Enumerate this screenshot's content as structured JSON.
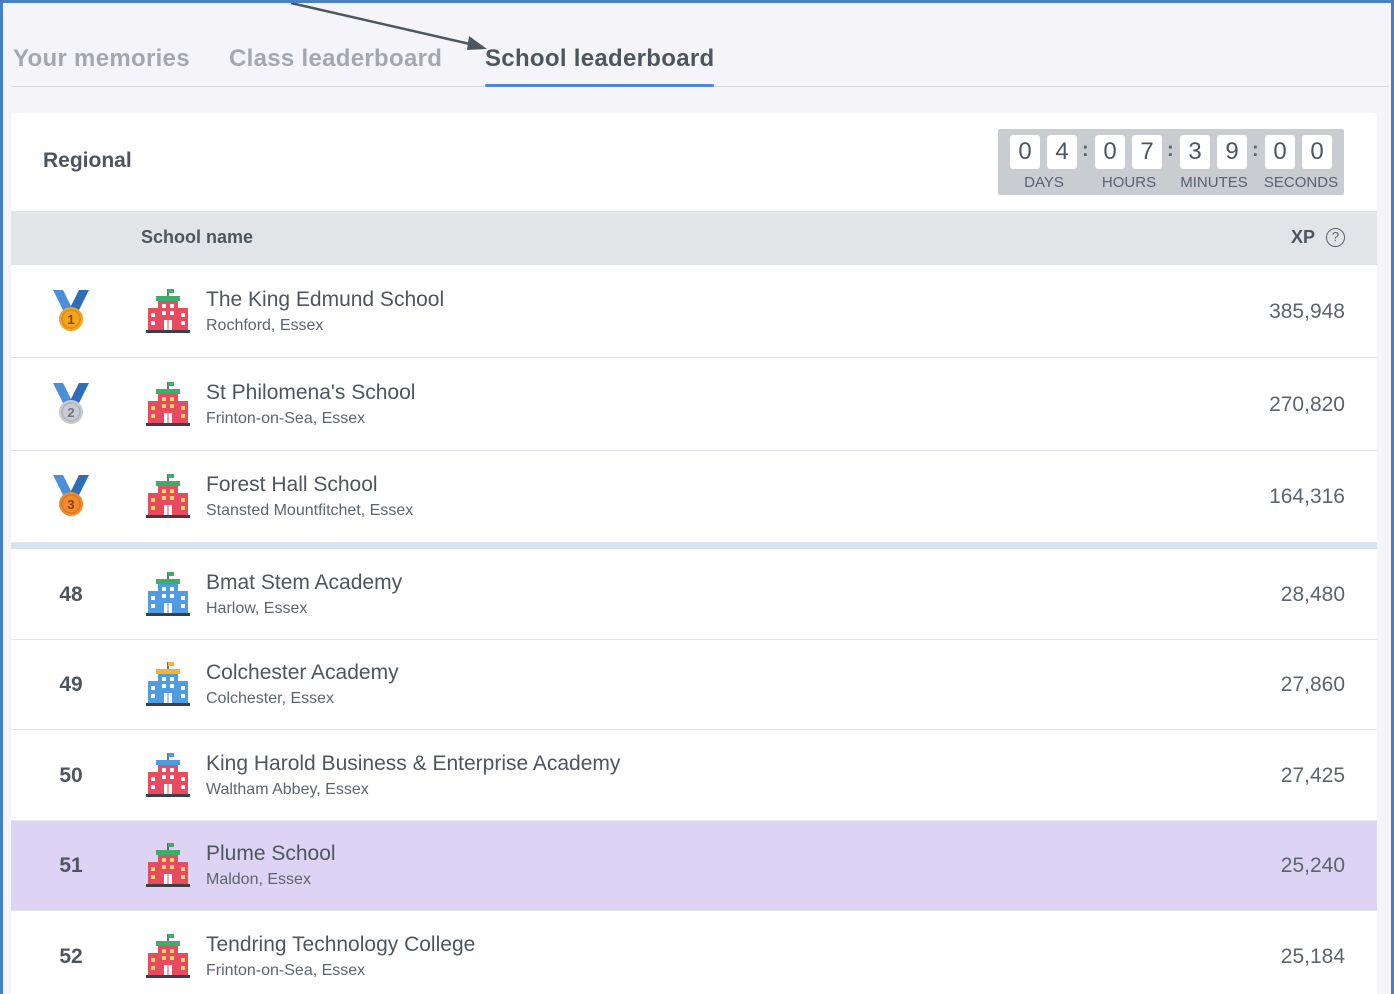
{
  "tabs": [
    {
      "label": "Your memories"
    },
    {
      "label": "Class leaderboard"
    },
    {
      "label": "School leaderboard"
    }
  ],
  "header": {
    "title": "Regional",
    "timer": {
      "days": [
        "0",
        "4"
      ],
      "hours": [
        "0",
        "7"
      ],
      "minutes": [
        "3",
        "9"
      ],
      "seconds": [
        "0",
        "0"
      ],
      "labels": {
        "days": "DAYS",
        "hours": "HOURS",
        "minutes": "MINUTES",
        "seconds": "SECONDS"
      }
    }
  },
  "table": {
    "col_name": "School name",
    "col_xp": "XP",
    "help_glyph": "?",
    "rows": [
      {
        "rank": "1",
        "medal": "gold",
        "icon": "school-building-green-icon",
        "name": "The King Edmund School",
        "location": "Rochford, Essex",
        "xp": "385,948"
      },
      {
        "rank": "2",
        "medal": "silver",
        "icon": "school-building-red-icon",
        "name": "St Philomena's School",
        "location": "Frinton-on-Sea, Essex",
        "xp": "270,820"
      },
      {
        "rank": "3",
        "medal": "bronze",
        "icon": "school-building-red-icon",
        "name": "Forest Hall School",
        "location": "Stansted Mountfitchet, Essex",
        "xp": "164,316"
      },
      {
        "rank": "48",
        "icon": "school-building-blue-icon",
        "name": "Bmat Stem Academy",
        "location": "Harlow, Essex",
        "xp": "28,480"
      },
      {
        "rank": "49",
        "icon": "school-building-yellow-icon",
        "name": "Colchester Academy",
        "location": "Colchester, Essex",
        "xp": "27,860"
      },
      {
        "rank": "50",
        "icon": "school-building-pink-icon",
        "name": "King Harold Business & Enterprise Academy",
        "location": "Waltham Abbey, Essex",
        "xp": "27,425"
      },
      {
        "rank": "51",
        "icon": "school-building-red-icon",
        "name": "Plume School",
        "location": "Maldon, Essex",
        "xp": "25,240",
        "highlighted": true
      },
      {
        "rank": "52",
        "icon": "school-building-red-icon",
        "name": "Tendring Technology College",
        "location": "Frinton-on-Sea, Essex",
        "xp": "25,184"
      }
    ]
  },
  "colors": {
    "accent": "#4a88e0",
    "highlight_row": "#dcd3f5",
    "gold": "#f2a41f",
    "silver": "#c8ccd2",
    "bronze": "#f08a2c",
    "medal_ribbon": "#4a8fd8"
  }
}
